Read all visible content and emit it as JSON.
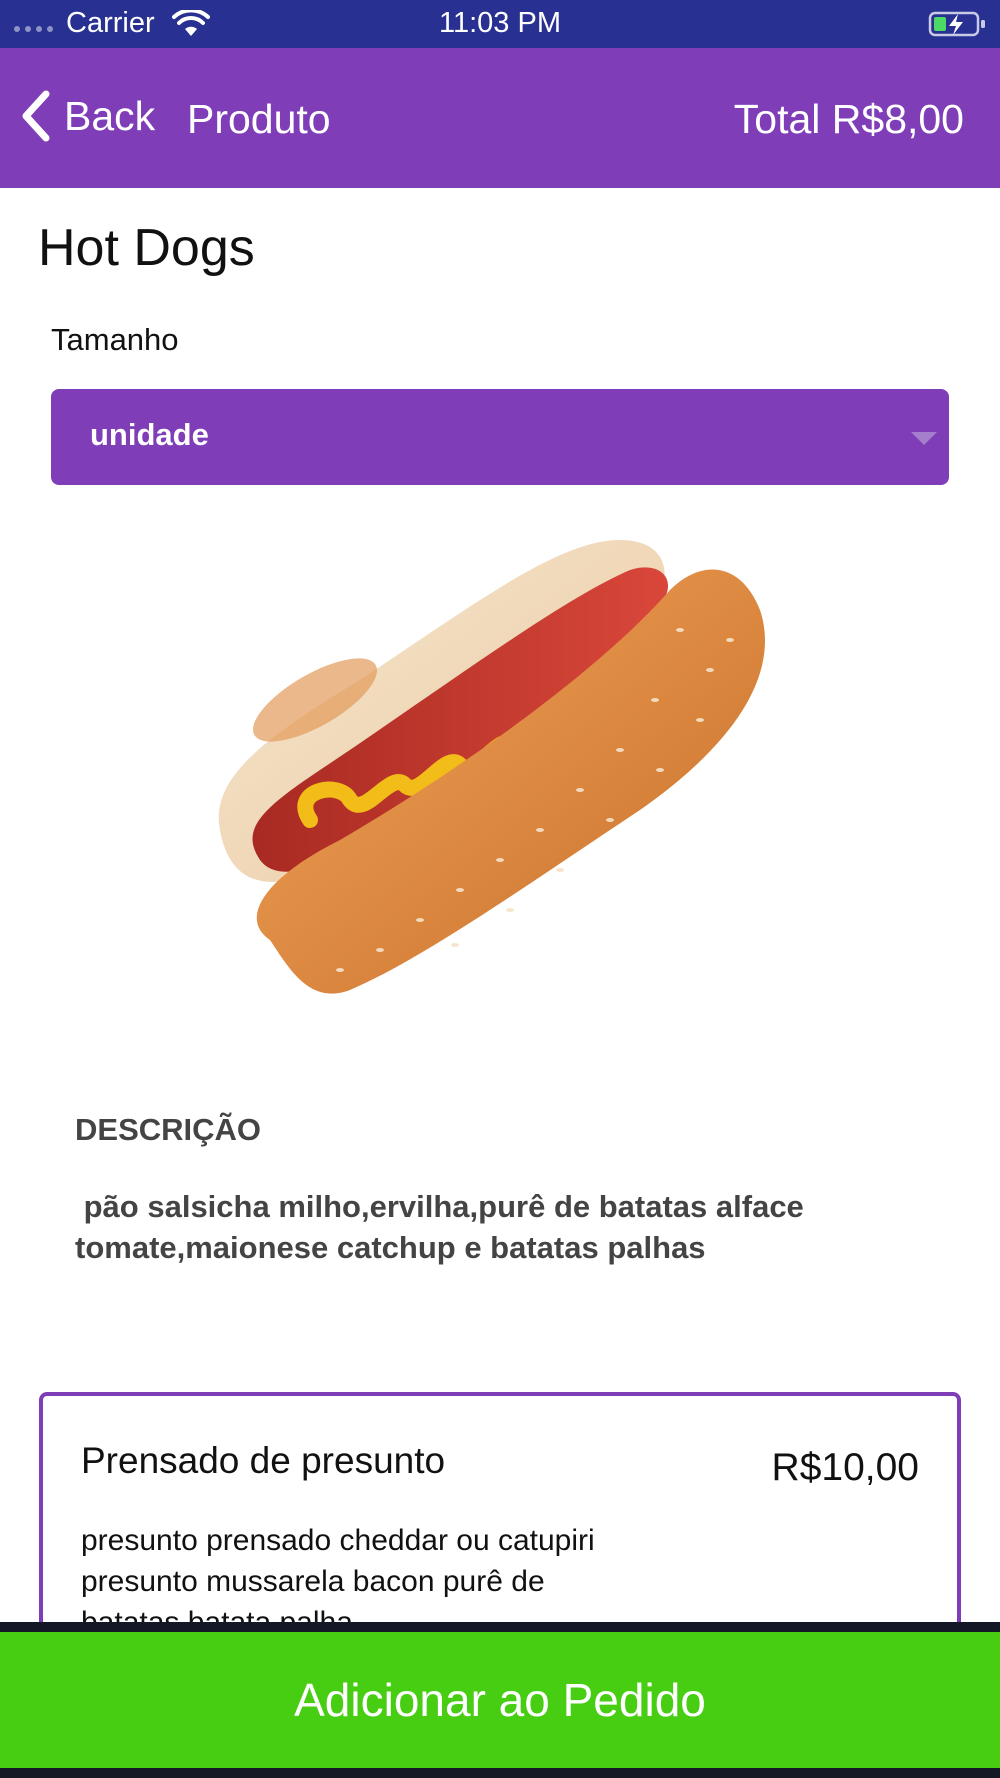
{
  "status_bar": {
    "carrier": "Carrier",
    "time": "11:03 PM",
    "icons": [
      "signal-dots-icon",
      "wifi-icon",
      "battery-charging-icon"
    ]
  },
  "nav": {
    "back_label": "Back",
    "title": "Produto",
    "total": "Total R$8,00",
    "color": "#7f3db8"
  },
  "product": {
    "name": "Hot Dogs",
    "size_label": "Tamanho",
    "size_selected": "unidade",
    "image_icon": "hot-dog-image",
    "description_heading": "DESCRIÇÃO",
    "description": " pão salsicha milho,ervilha,purê de batatas alface tomate,maionese catchup e batatas palhas"
  },
  "option": {
    "name": "Prensado de presunto",
    "price": "R$10,00",
    "description": "presunto prensado cheddar ou catupiri presunto mussarela bacon purê de batatas batata palha"
  },
  "action": {
    "add_label": "Adicionar ao Pedido",
    "color": "#47cd12"
  }
}
